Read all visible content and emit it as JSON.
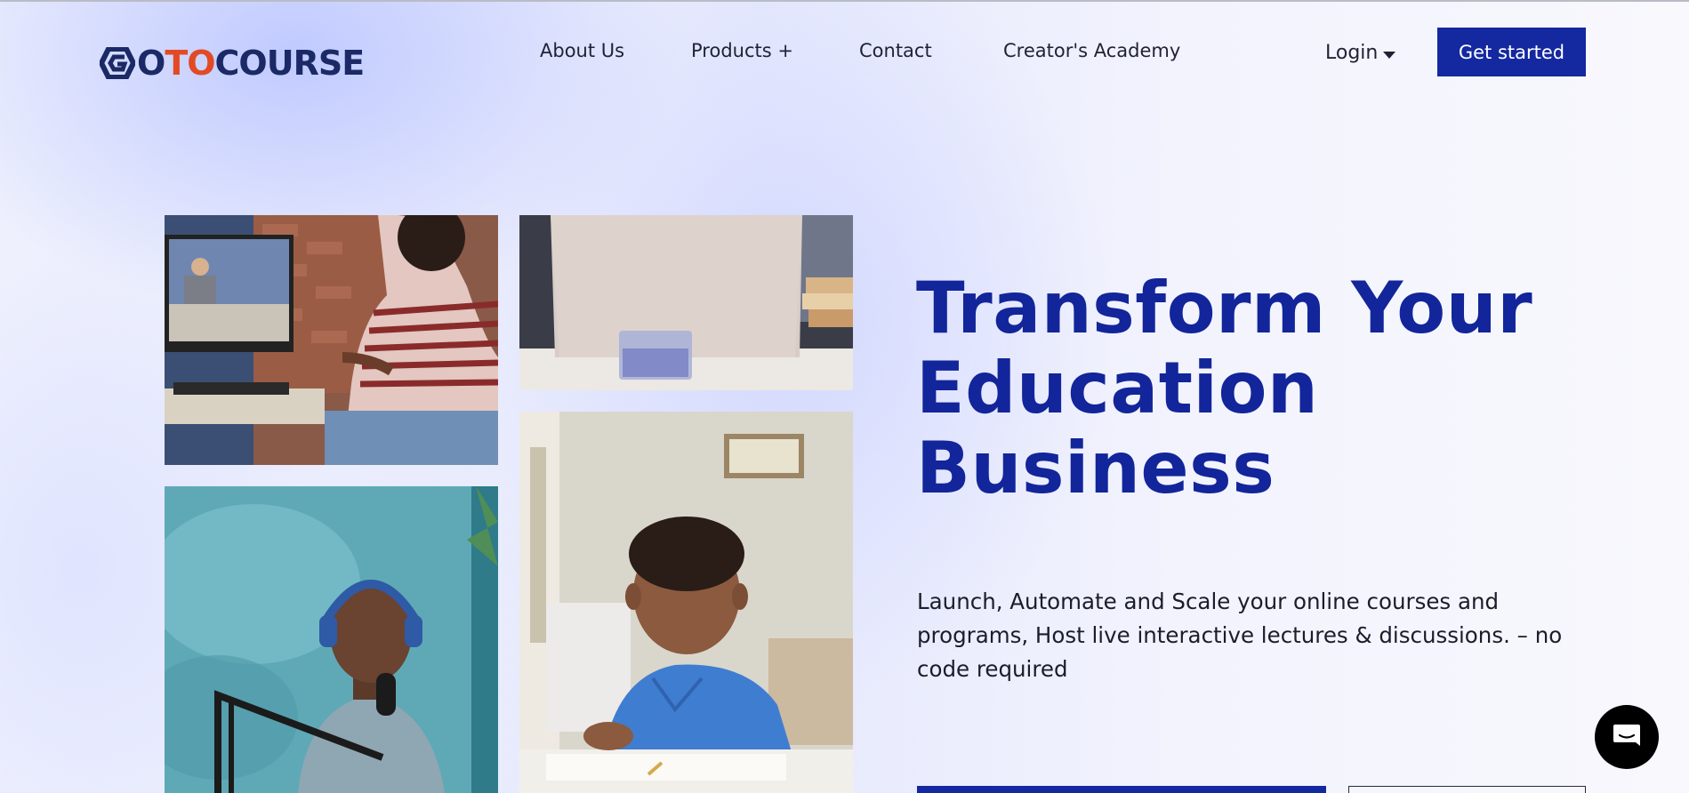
{
  "header": {
    "logo": {
      "prefix": "G",
      "o1": "O",
      "to": "TO",
      "rest": "COURSE"
    },
    "nav": [
      {
        "label": "About Us"
      },
      {
        "label": "Products +"
      },
      {
        "label": "Contact"
      },
      {
        "label": "Creator's Academy"
      }
    ],
    "login_label": "Login",
    "cta_label": "Get started"
  },
  "hero": {
    "title_lines": [
      "Transform Your",
      "Education",
      "Business"
    ],
    "subtitle": "Launch, Automate and Scale your online courses and programs, Host live interactive lectures & discussions. – no code required"
  },
  "icons": {
    "logo": "gotocourse-logo-icon",
    "caret": "caret-down-icon",
    "chat": "chat-bubble-icon"
  },
  "colors": {
    "brand_blue": "#1428a0",
    "title_blue": "#12259a",
    "logo_navy": "#1b2a66",
    "logo_orange": "#e24a25"
  }
}
